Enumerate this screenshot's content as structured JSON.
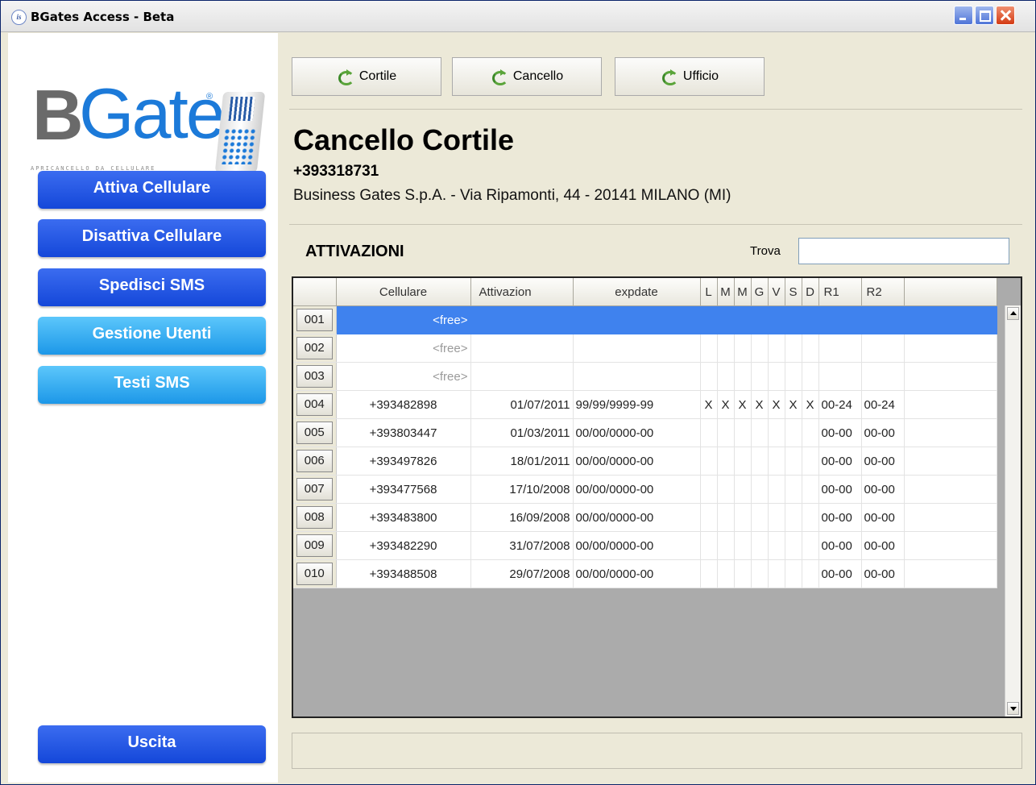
{
  "window": {
    "title": "BGates Access - Beta",
    "icon_text": "is"
  },
  "logo": {
    "brand_b": "B",
    "brand_rest": "Gates",
    "registered": "®",
    "tagline": "APRICANCELLO DA CELLULARE"
  },
  "sidebar": {
    "buttons": [
      "Attiva Cellulare",
      "Disattiva Cellulare",
      "Spedisci SMS",
      "Gestione Utenti",
      "Testi SMS"
    ],
    "exit": "Uscita"
  },
  "gate_buttons": [
    "Cortile",
    "Cancello",
    "Ufficio"
  ],
  "gate": {
    "title": "Cancello Cortile",
    "phone": "+393318731",
    "address": "Business Gates S.p.A. - Via Ripamonti, 44 - 20141 MILANO (MI)"
  },
  "activations": {
    "title": "ATTIVAZIONI",
    "find_label": "Trova",
    "find_value": "",
    "columns": [
      "",
      "Cellulare",
      "Attivazion",
      "expdate",
      "L",
      "M",
      "M",
      "G",
      "V",
      "S",
      "D",
      "R1",
      "R2",
      ""
    ],
    "rows": [
      [
        "001",
        "<free>",
        "",
        "",
        "",
        "",
        "",
        "",
        "",
        "",
        "",
        "",
        ""
      ],
      [
        "002",
        "<free>",
        "",
        "",
        "",
        "",
        "",
        "",
        "",
        "",
        "",
        "",
        ""
      ],
      [
        "003",
        "<free>",
        "",
        "",
        "",
        "",
        "",
        "",
        "",
        "",
        "",
        "",
        ""
      ],
      [
        "004",
        "+393482898",
        "01/07/2011",
        "99/99/9999-99",
        "X",
        "X",
        "X",
        "X",
        "X",
        "X",
        "X",
        "00-24",
        "00-24"
      ],
      [
        "005",
        "+393803447",
        "01/03/2011",
        "00/00/0000-00",
        "",
        "",
        "",
        "",
        "",
        "",
        "",
        "00-00",
        "00-00"
      ],
      [
        "006",
        "+393497826",
        "18/01/2011",
        "00/00/0000-00",
        "",
        "",
        "",
        "",
        "",
        "",
        "",
        "00-00",
        "00-00"
      ],
      [
        "007",
        "+393477568",
        "17/10/2008",
        "00/00/0000-00",
        "",
        "",
        "",
        "",
        "",
        "",
        "",
        "00-00",
        "00-00"
      ],
      [
        "008",
        "+393483800",
        "16/09/2008",
        "00/00/0000-00",
        "",
        "",
        "",
        "",
        "",
        "",
        "",
        "00-00",
        "00-00"
      ],
      [
        "009",
        "+393482290",
        "31/07/2008",
        "00/00/0000-00",
        "",
        "",
        "",
        "",
        "",
        "",
        "",
        "00-00",
        "00-00"
      ],
      [
        "010",
        "+393488508",
        "29/07/2008",
        "00/00/0000-00",
        "",
        "",
        "",
        "",
        "",
        "",
        "",
        "00-00",
        "00-00"
      ]
    ],
    "selected_row": 0
  },
  "status": {
    "text": ""
  },
  "colors": {
    "selection": "#3f82ee",
    "dark_button": "#1447d9",
    "light_button": "#1c97e8",
    "panel": "#ece9d8"
  }
}
